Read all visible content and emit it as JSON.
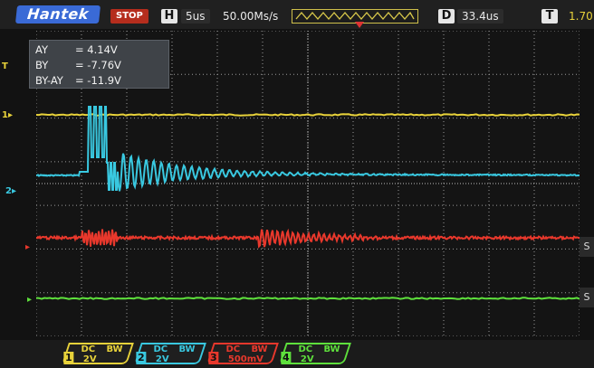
{
  "header": {
    "brand": "Hantek",
    "run_state": "STOP",
    "timebase_label": "H",
    "timebase_value": "5us",
    "sample_rate": "50.00Ms/s",
    "delay_label": "D",
    "delay_value": "33.4us",
    "trigger_label": "T",
    "trigger_value": "1.70"
  },
  "cursors": {
    "rows": [
      {
        "label": "AY",
        "value": "= 4.14V"
      },
      {
        "label": "BY",
        "value": "= -7.76V"
      },
      {
        "label": "BY-AY",
        "value": "= -11.9V"
      }
    ]
  },
  "channels": [
    {
      "num": "1",
      "coupling": "DC",
      "bw": "BW",
      "scale": "2V",
      "color": "#e8d23a"
    },
    {
      "num": "2",
      "coupling": "DC",
      "bw": "BW",
      "scale": "2V",
      "color": "#39c8e0"
    },
    {
      "num": "3",
      "coupling": "DC",
      "bw": "BW",
      "scale": "500mV",
      "color": "#e8382c"
    },
    {
      "num": "4",
      "coupling": "DC",
      "bw": "BW",
      "scale": "2V",
      "color": "#5ee03c"
    }
  ],
  "side_labels": {
    "right_top": "S",
    "right_bottom": "S"
  },
  "icons": {
    "trigger_pos": "trigger-position-arrow-icon",
    "ch1": "ch1-ground-marker-icon",
    "ch2": "ch2-ground-marker-icon",
    "ch3": "ch3-ground-marker-icon",
    "ch4": "ch4-ground-marker-icon"
  }
}
